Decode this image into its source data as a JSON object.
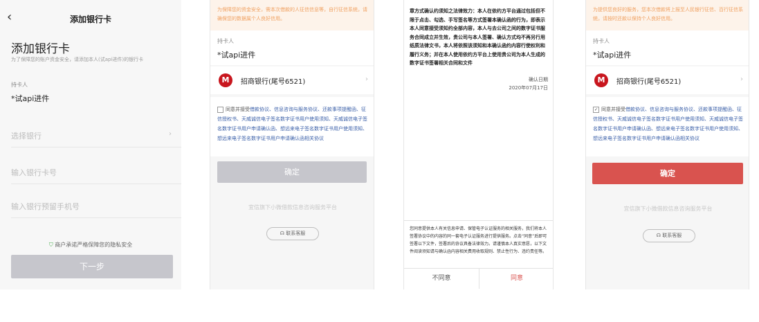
{
  "screen1": {
    "back_icon": "‹",
    "nav_title": "添加银行卡",
    "heading": "添加银行卡",
    "subtitle": "为了保障您的账户资金安全，请添加本人(试api进件)的银行卡",
    "holder_label": "持卡人",
    "holder_value": "*试api进件",
    "bank_placeholder": "选择银行",
    "card_placeholder": "输入银行卡号",
    "phone_placeholder": "输入银行预留手机号",
    "security_note": "商户承诺严格保障您的隐私安全",
    "next_button": "下一步"
  },
  "screen2": {
    "warning": "为保障您的资金安全，需本次借款的人征信信息等，自行征信系统，请确保您的数据属个人良好信用。",
    "holder_label": "持卡人",
    "holder_value": "*试api进件",
    "bank_logo": "M",
    "bank_name": "招商银行(尾号6521)",
    "agreement_prefix": "同意并接受",
    "agreement_text": "借款协议、信息咨询与服务协议、还款事项提醒函、征信授权书、天威诚信电子签名数字证书用户使用须知、天威诚信电子签名数字证书用户申请确认函、想远来电子签名数字证书用户使用须知、想远来电子签名数字证书用户申请确认函相关协议",
    "confirm_button": "确定",
    "platform": "宜信旗下小微借款信息咨询服务平台",
    "service_button": "联系客服"
  },
  "screen3": {
    "doc_text": "章方式确认约须知之法律效力：本人在依约方平台通过包括但不限于点击、勾选、手写签名等方式签署本确认函的行为，即表示本人同意接受须知约全部内容，本人与去公司之间的数字证书服务合同成立并生效，贵公司与本人签署、确认方式均不再另行用纸质法律文书，本人将依照该须知和本确认函约内容行使权利和履行义务；并在本人使用依约方平台上使用贵公司为本人生成的数字证书签署相关合同和文件",
    "signer_label": "确认日期",
    "date": "2020年07月17日",
    "dialog_text": "您同意提供本人有关信息申请、保管电子认证服务的相关服务，我们将本人签署协议中的内容的同一套电子认证服务进行提供服务。点击“同意”后即可签署以下文件，签署后的协议具备法律效力。请谨慎本人真实意愿，以下文件阅读须知请与确认函内容相关费用收取规则、禁止性行为、违约责任等。",
    "disagree_button": "不同意",
    "agree_button": "同意"
  },
  "screen4": {
    "warning": "为提供您良好的服务，您本次借款将上报至人民银行征信、百行征信系统，请按时还款以保持个人良好信用。",
    "holder_label": "持卡人",
    "holder_value": "*试api进件",
    "bank_logo": "M",
    "bank_name": "招商银行(尾号6521)",
    "agreement_prefix": "同意并接受",
    "agreement_text": "借款协议、信息咨询与服务协议、还款事项提醒函、征信授权书、天威诚信电子签名数字证书用户使用须知、天威诚信电子签名数字证书用户申请确认函、想远来电子签名数字证书用户使用须知、想远来电子签名数字证书用户申请确认函相关协议",
    "checkbox_mark": "✓",
    "confirm_button": "确定",
    "platform": "宜信旗下小微借款信息咨询服务平台",
    "service_button": "联系客服"
  },
  "colors": {
    "brand_red": "#d9534f",
    "disabled_gray": "#c6c6cc",
    "link_blue": "#3a5fa8",
    "warning_orange": "#f0a060"
  }
}
